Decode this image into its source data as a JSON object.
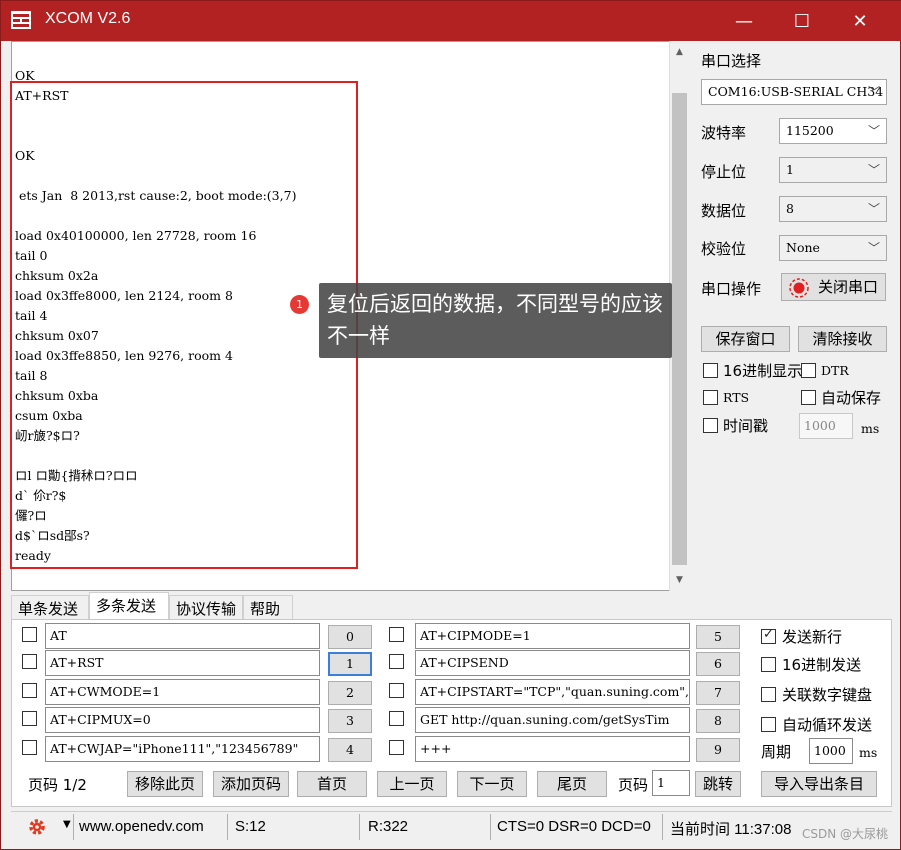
{
  "window": {
    "title": "XCOM V2.6",
    "minimize_glyph": "—",
    "maximize_glyph": "☐",
    "close_glyph": "✕"
  },
  "receive": {
    "lines": [
      "OK",
      "AT+RST",
      "",
      "",
      "OK",
      "",
      " ets Jan  8 2013,rst cause:2, boot mode:(3,7)",
      "",
      "load 0x40100000, len 27728, room 16",
      "tail 0",
      "chksum 0x2a",
      "load 0x3ffe8000, len 2124, room 8",
      "tail 4",
      "chksum 0x07",
      "load 0x3ffe8850, len 9276, room 4",
      "tail 8",
      "chksum 0xba",
      "csum 0xba",
      "屻r旇?$ロ?",
      "",
      "ロl ロ勩{揹秫ロ?ロロ",
      "d` 伱r?$",
      "儸?ロ",
      "d$`ロsd郘s?",
      "ready"
    ],
    "callout_number": "1",
    "callout_text": "复位后返回的数据，不同型号的应该不一样"
  },
  "settings": {
    "port_label": "串口选择",
    "port_value": "COM16:USB-SERIAL CH34",
    "baud_label": "波特率",
    "baud_value": "115200",
    "stopbits_label": "停止位",
    "stopbits_value": "1",
    "databits_label": "数据位",
    "databits_value": "8",
    "parity_label": "校验位",
    "parity_value": "None",
    "operation_label": "串口操作",
    "close_port_label": "关闭串口",
    "save_window_label": "保存窗口",
    "clear_recv_label": "清除接收",
    "hex_display_label": "16进制显示",
    "dtr_label": "DTR",
    "rts_label": "RTS",
    "auto_save_label": "自动保存",
    "timestamp_label": "时间戳",
    "timestamp_value": "1000",
    "timestamp_unit": "ms"
  },
  "tabs": [
    "单条发送",
    "多条发送",
    "协议传输",
    "帮助"
  ],
  "multi_send": {
    "left": [
      {
        "text": "AT",
        "num": "0"
      },
      {
        "text": "AT+RST",
        "num": "1"
      },
      {
        "text": "AT+CWMODE=1",
        "num": "2"
      },
      {
        "text": "AT+CIPMUX=0",
        "num": "3"
      },
      {
        "text": "AT+CWJAP=\"iPhone111\",\"123456789\"",
        "num": "4"
      }
    ],
    "right": [
      {
        "text": "AT+CIPMODE=1",
        "num": "5"
      },
      {
        "text": "AT+CIPSEND",
        "num": "6"
      },
      {
        "text": "AT+CIPSTART=\"TCP\",\"quan.suning.com\",",
        "num": "7"
      },
      {
        "text": "GET http://quan.suning.com/getSysTim",
        "num": "8"
      },
      {
        "text": "+++",
        "num": "9"
      }
    ],
    "send_newline_label": "发送新行",
    "hex_send_label": "16进制发送",
    "link_keyboard_label": "关联数字键盘",
    "auto_loop_label": "自动循环发送",
    "period_label": "周期",
    "period_value": "1000",
    "period_unit": "ms",
    "page_label": "页码 1/2",
    "remove_page_label": "移除此页",
    "add_page_label": "添加页码",
    "first_page_label": "首页",
    "prev_page_label": "上一页",
    "next_page_label": "下一页",
    "last_page_label": "尾页",
    "page_input_label": "页码",
    "page_input_value": "1",
    "jump_label": "跳转",
    "import_export_label": "导入导出条目"
  },
  "status": {
    "url": "www.openedv.com",
    "sent": "S:12",
    "received": "R:322",
    "lines": "CTS=0 DSR=0 DCD=0",
    "time": "当前时间 11:37:08",
    "watermark": "CSDN @大尿桃"
  }
}
